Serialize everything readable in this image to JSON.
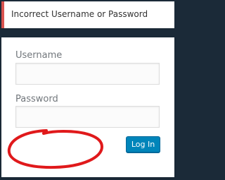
{
  "error": {
    "message": "Incorrect Username or Password",
    "accent_color": "#d9534f"
  },
  "login_form": {
    "username_label": "Username",
    "username_value": "",
    "password_label": "Password",
    "password_value": "",
    "submit_label": "Log In",
    "submit_color": "#0085ba"
  },
  "annotation": {
    "shape": "hand-drawn circle",
    "color": "#e0191b"
  },
  "background_color": "#1b2a38"
}
